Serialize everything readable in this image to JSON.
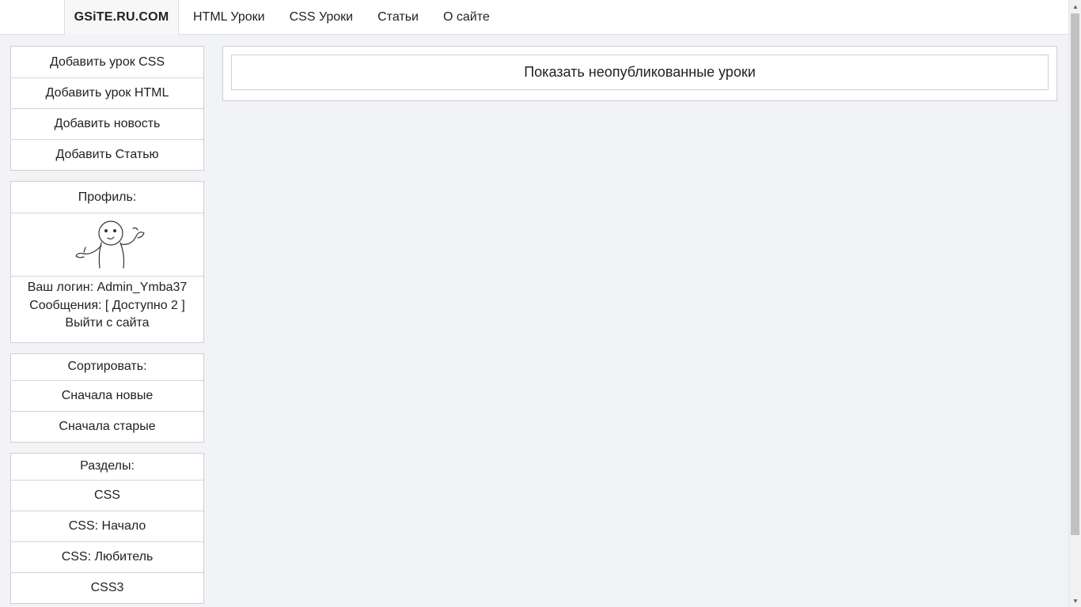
{
  "nav": {
    "logo": "GSiTE.RU.COM",
    "links": [
      "HTML Уроки",
      "CSS Уроки",
      "Статьи",
      "О сайте"
    ]
  },
  "admin_actions": [
    "Добавить урок CSS",
    "Добавить урок HTML",
    "Добавить новость",
    "Добавить Статью"
  ],
  "profile": {
    "title": "Профиль:",
    "avatar_icon": "shrug-meme-avatar",
    "login_line": "Ваш логин: Admin_Ymba37",
    "messages_line": "Сообщения: [ Доступно 2 ]",
    "logout": "Выйти с сайта"
  },
  "sort": {
    "title": "Сортировать:",
    "options": [
      "Сначала новые",
      "Сначала старые"
    ]
  },
  "sections": {
    "title": "Разделы:",
    "items": [
      "CSS",
      "CSS: Начало",
      "CSS: Любитель",
      "CSS3"
    ]
  },
  "main": {
    "show_unpublished": "Показать неопубликованные уроки"
  },
  "scrollbar": {
    "up_icon": "▲",
    "down_icon": "▼"
  }
}
